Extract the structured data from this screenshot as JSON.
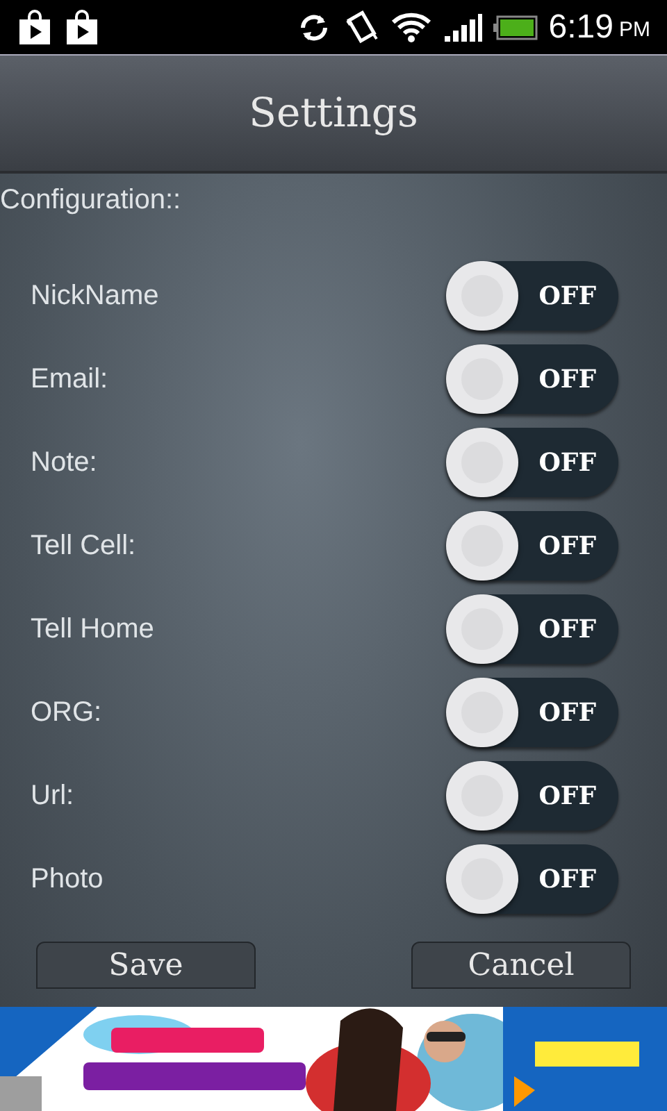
{
  "status_bar": {
    "time": "6:19",
    "meridiem": "PM"
  },
  "header": {
    "title": "Settings"
  },
  "section_label": "Configuration::",
  "settings": [
    {
      "label": "NickName",
      "toggle": {
        "on": false,
        "text": "OFF"
      }
    },
    {
      "label": "Email:",
      "toggle": {
        "on": false,
        "text": "OFF"
      }
    },
    {
      "label": "Note:",
      "toggle": {
        "on": false,
        "text": "OFF"
      }
    },
    {
      "label": "Tell Cell:",
      "toggle": {
        "on": false,
        "text": "OFF"
      }
    },
    {
      "label": "Tell Home",
      "toggle": {
        "on": false,
        "text": "OFF"
      }
    },
    {
      "label": "ORG:",
      "toggle": {
        "on": false,
        "text": "OFF"
      }
    },
    {
      "label": "Url:",
      "toggle": {
        "on": false,
        "text": "OFF"
      }
    },
    {
      "label": "Photo",
      "toggle": {
        "on": false,
        "text": "OFF"
      }
    }
  ],
  "buttons": [
    "Save",
    "Cancel"
  ]
}
